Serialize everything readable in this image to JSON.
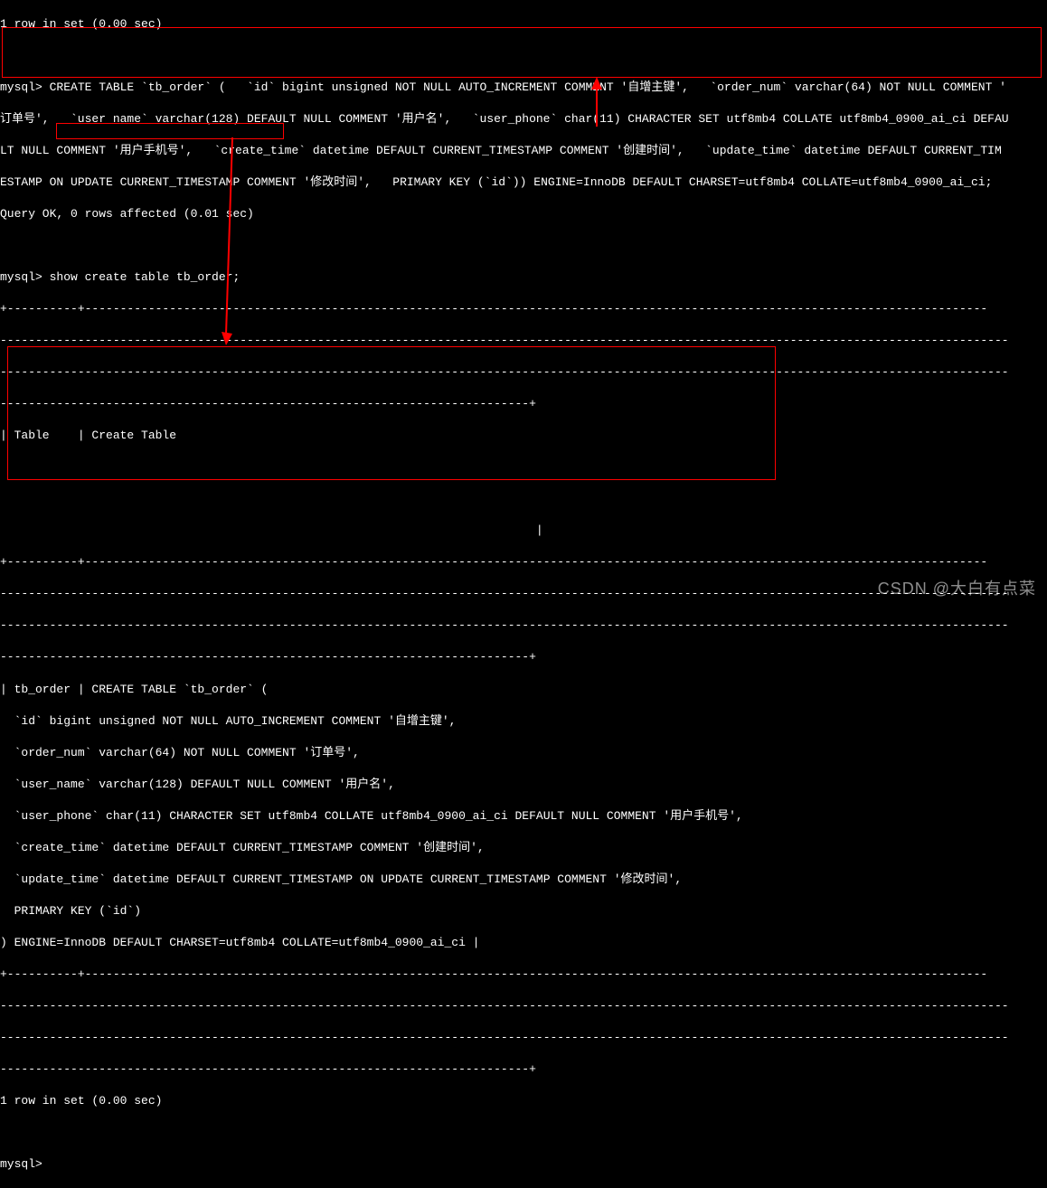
{
  "terminal": {
    "line01": "1 row in set (0.00 sec)",
    "line02": "",
    "line03": "mysql> CREATE TABLE `tb_order` (   `id` bigint unsigned NOT NULL AUTO_INCREMENT COMMENT '自增主键',   `order_num` varchar(64) NOT NULL COMMENT '",
    "line04": "订单号',   `user_name` varchar(128) DEFAULT NULL COMMENT '用户名',   `user_phone` char(11) CHARACTER SET utf8mb4 COLLATE utf8mb4_0900_ai_ci DEFAU",
    "line05": "LT NULL COMMENT '用户手机号',   `create_time` datetime DEFAULT CURRENT_TIMESTAMP COMMENT '创建时间',   `update_time` datetime DEFAULT CURRENT_TIM",
    "line06": "ESTAMP ON UPDATE CURRENT_TIMESTAMP COMMENT '修改时间',   PRIMARY KEY (`id`)) ENGINE=InnoDB DEFAULT CHARSET=utf8mb4 COLLATE=utf8mb4_0900_ai_ci;",
    "line07": "Query OK, 0 rows affected (0.01 sec)",
    "line08": "",
    "line09": "mysql> show create table tb_order;",
    "line10": "+----------+--------------------------------------------------------------------------------------------------------------------------------",
    "line11": "-----------------------------------------------------------------------------------------------------------------------------------------------",
    "line12": "-----------------------------------------------------------------------------------------------------------------------------------------------",
    "line13": "---------------------------------------------------------------------------+",
    "line14": "| Table    | Create Table",
    "line15": "",
    "line16": "",
    "line17": "                                                                            |",
    "line18": "+----------+--------------------------------------------------------------------------------------------------------------------------------",
    "line19": "-----------------------------------------------------------------------------------------------------------------------------------------------",
    "line20": "-----------------------------------------------------------------------------------------------------------------------------------------------",
    "line21": "---------------------------------------------------------------------------+",
    "line22": "| tb_order | CREATE TABLE `tb_order` (",
    "line23": "  `id` bigint unsigned NOT NULL AUTO_INCREMENT COMMENT '自增主键',",
    "line24": "  `order_num` varchar(64) NOT NULL COMMENT '订单号',",
    "line25": "  `user_name` varchar(128) DEFAULT NULL COMMENT '用户名',",
    "line26": "  `user_phone` char(11) CHARACTER SET utf8mb4 COLLATE utf8mb4_0900_ai_ci DEFAULT NULL COMMENT '用户手机号',",
    "line27": "  `create_time` datetime DEFAULT CURRENT_TIMESTAMP COMMENT '创建时间',",
    "line28": "  `update_time` datetime DEFAULT CURRENT_TIMESTAMP ON UPDATE CURRENT_TIMESTAMP COMMENT '修改时间',",
    "line29": "  PRIMARY KEY (`id`)",
    "line30": ") ENGINE=InnoDB DEFAULT CHARSET=utf8mb4 COLLATE=utf8mb4_0900_ai_ci |",
    "line31": "+----------+--------------------------------------------------------------------------------------------------------------------------------",
    "line32": "-----------------------------------------------------------------------------------------------------------------------------------------------",
    "line33": "-----------------------------------------------------------------------------------------------------------------------------------------------",
    "line34": "---------------------------------------------------------------------------+",
    "line35": "1 row in set (0.00 sec)",
    "line36": "",
    "line37": "mysql>"
  },
  "watermark": "CSDN @大白有点菜"
}
